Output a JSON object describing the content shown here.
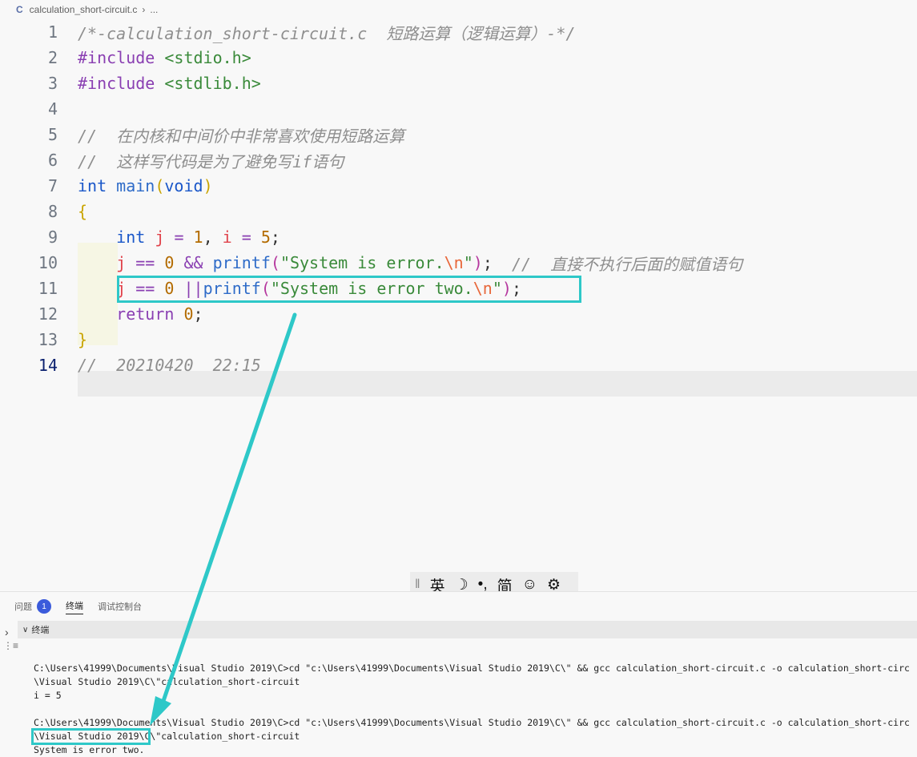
{
  "breadcrumb": {
    "lang_icon": "C",
    "file": "calculation_short-circuit.c",
    "more": "..."
  },
  "editor": {
    "lines": [
      {
        "num": "1",
        "tokens": [
          {
            "c": "cmt",
            "t": "/*-calculation_short-circuit.c  短路运算（逻辑运算）-*/"
          }
        ]
      },
      {
        "num": "2",
        "tokens": [
          {
            "c": "kw",
            "t": "#include"
          },
          {
            "c": "plain",
            "t": " "
          },
          {
            "c": "str",
            "t": "<stdio.h>"
          }
        ]
      },
      {
        "num": "3",
        "tokens": [
          {
            "c": "kw",
            "t": "#include"
          },
          {
            "c": "plain",
            "t": " "
          },
          {
            "c": "str",
            "t": "<stdlib.h>"
          }
        ]
      },
      {
        "num": "4",
        "tokens": []
      },
      {
        "num": "5",
        "tokens": [
          {
            "c": "cmt",
            "t": "//  在内核和中间价中非常喜欢使用短路运算"
          }
        ]
      },
      {
        "num": "6",
        "tokens": [
          {
            "c": "cmt",
            "t": "//  这样写代码是为了避免写if语句"
          }
        ]
      },
      {
        "num": "7",
        "tokens": [
          {
            "c": "typ",
            "t": "int"
          },
          {
            "c": "plain",
            "t": " "
          },
          {
            "c": "fn",
            "t": "main"
          },
          {
            "c": "brace",
            "t": "("
          },
          {
            "c": "typ",
            "t": "void"
          },
          {
            "c": "brace",
            "t": ")"
          }
        ]
      },
      {
        "num": "8",
        "tokens": [
          {
            "c": "brace",
            "t": "{"
          }
        ]
      },
      {
        "num": "9",
        "tokens": [
          {
            "c": "plain",
            "t": "    "
          },
          {
            "c": "typ",
            "t": "int"
          },
          {
            "c": "plain",
            "t": " "
          },
          {
            "c": "var",
            "t": "j"
          },
          {
            "c": "plain",
            "t": " "
          },
          {
            "c": "op",
            "t": "="
          },
          {
            "c": "plain",
            "t": " "
          },
          {
            "c": "num",
            "t": "1"
          },
          {
            "c": "plain",
            "t": ", "
          },
          {
            "c": "var",
            "t": "i"
          },
          {
            "c": "plain",
            "t": " "
          },
          {
            "c": "op",
            "t": "="
          },
          {
            "c": "plain",
            "t": " "
          },
          {
            "c": "num",
            "t": "5"
          },
          {
            "c": "plain",
            "t": ";"
          }
        ]
      },
      {
        "num": "10",
        "tokens": [
          {
            "c": "plain",
            "t": "    "
          },
          {
            "c": "var",
            "t": "j"
          },
          {
            "c": "plain",
            "t": " "
          },
          {
            "c": "op",
            "t": "=="
          },
          {
            "c": "plain",
            "t": " "
          },
          {
            "c": "num",
            "t": "0"
          },
          {
            "c": "plain",
            "t": " "
          },
          {
            "c": "op",
            "t": "&&"
          },
          {
            "c": "plain",
            "t": " "
          },
          {
            "c": "fn",
            "t": "printf"
          },
          {
            "c": "paren",
            "t": "("
          },
          {
            "c": "str",
            "t": "\"System is error."
          },
          {
            "c": "esc",
            "t": "\\n"
          },
          {
            "c": "str",
            "t": "\""
          },
          {
            "c": "paren",
            "t": ")"
          },
          {
            "c": "plain",
            "t": ";  "
          },
          {
            "c": "cmt",
            "t": "//  直接不执行后面的赋值语句"
          }
        ]
      },
      {
        "num": "11",
        "tokens": [
          {
            "c": "plain",
            "t": "    "
          },
          {
            "c": "var",
            "t": "j"
          },
          {
            "c": "plain",
            "t": " "
          },
          {
            "c": "op",
            "t": "=="
          },
          {
            "c": "plain",
            "t": " "
          },
          {
            "c": "num",
            "t": "0"
          },
          {
            "c": "plain",
            "t": " "
          },
          {
            "c": "op",
            "t": "||"
          },
          {
            "c": "fn",
            "t": "printf"
          },
          {
            "c": "paren",
            "t": "("
          },
          {
            "c": "str",
            "t": "\"System is error two."
          },
          {
            "c": "esc",
            "t": "\\n"
          },
          {
            "c": "str",
            "t": "\""
          },
          {
            "c": "paren",
            "t": ")"
          },
          {
            "c": "plain",
            "t": ";"
          }
        ]
      },
      {
        "num": "12",
        "tokens": [
          {
            "c": "plain",
            "t": "    "
          },
          {
            "c": "kw",
            "t": "return"
          },
          {
            "c": "plain",
            "t": " "
          },
          {
            "c": "num",
            "t": "0"
          },
          {
            "c": "plain",
            "t": ";"
          }
        ]
      },
      {
        "num": "13",
        "tokens": [
          {
            "c": "brace",
            "t": "}"
          }
        ]
      },
      {
        "num": "14",
        "tokens": [
          {
            "c": "cmt",
            "t": "//  20210420  22:15"
          }
        ]
      }
    ]
  },
  "ime": {
    "sep": "‖",
    "lang": "英",
    "moon": "☽",
    "punct": "•,",
    "mode": "简",
    "emoji": "☺",
    "settings": "⚙"
  },
  "panel": {
    "tabs": {
      "problems": "问题",
      "problems_count": "1",
      "terminal": "终端",
      "debug_console": "调试控制台"
    },
    "terminal_header": "终端",
    "terminal_lines": [
      "",
      "C:\\Users\\41999\\Documents\\Visual Studio 2019\\C>cd \"c:\\Users\\41999\\Documents\\Visual Studio 2019\\C\\\" && gcc calculation_short-circuit.c -o calculation_short-circ",
      "\\Visual Studio 2019\\C\\\"calculation_short-circuit",
      "i = 5",
      "",
      "C:\\Users\\41999\\Documents\\Visual Studio 2019\\C>cd \"c:\\Users\\41999\\Documents\\Visual Studio 2019\\C\\\" && gcc calculation_short-circuit.c -o calculation_short-circ",
      "\\Visual Studio 2019\\C\\\"calculation_short-circuit",
      "System is error two."
    ]
  },
  "colors": {
    "highlight": "#2ec8c8",
    "badge": "#3b5bdb"
  }
}
